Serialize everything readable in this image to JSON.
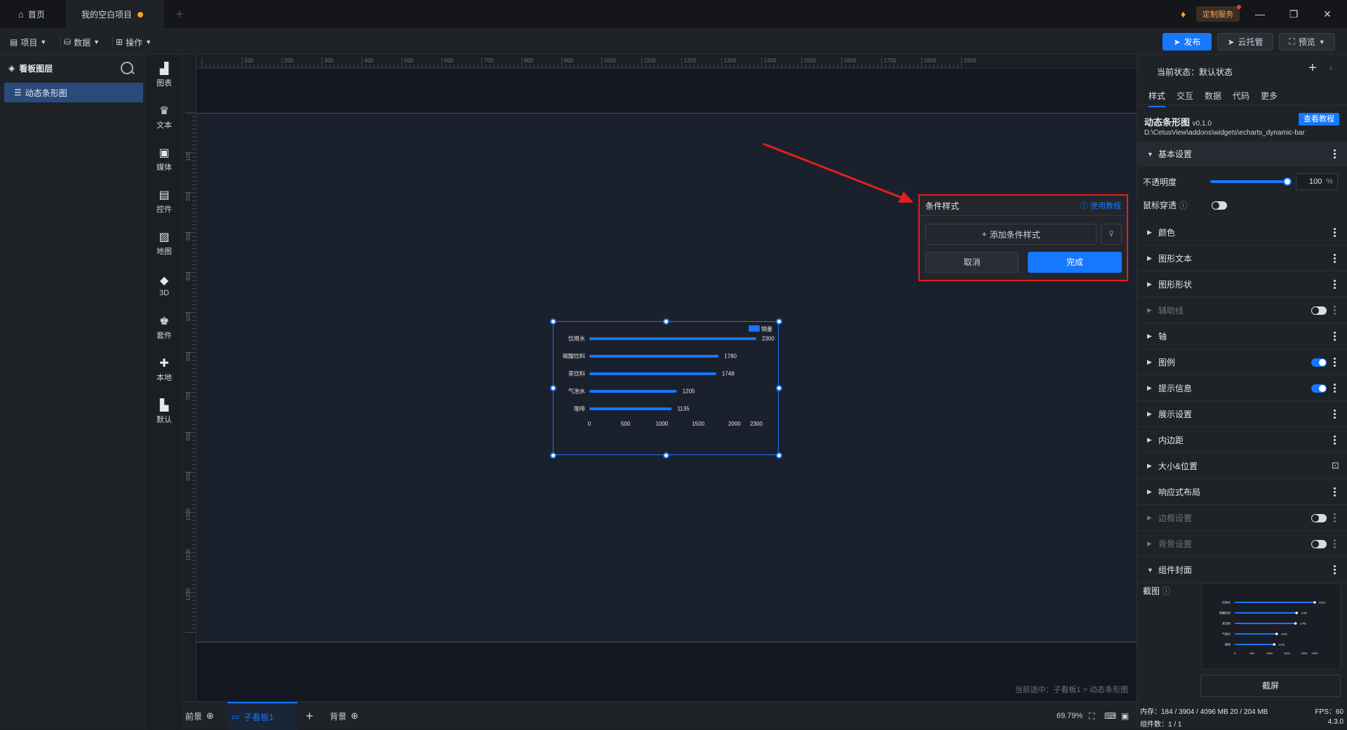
{
  "titlebar": {
    "home_label": "首页",
    "project_tab": "我的空白项目",
    "custom_service": "定制服务",
    "minimize": "—",
    "restore": "❐",
    "close": "✕"
  },
  "menubar": {
    "project": "项目",
    "data": "数据",
    "operate": "操作",
    "publish": "发布",
    "cloud": "云托管",
    "preview": "预览"
  },
  "layers": {
    "title": "看板图层",
    "items": [
      {
        "label": "动态条形图"
      }
    ]
  },
  "rail": [
    {
      "label": "图表",
      "icon": "bar-chart-icon"
    },
    {
      "label": "文本",
      "icon": "text-icon"
    },
    {
      "label": "媒体",
      "icon": "media-icon"
    },
    {
      "label": "控件",
      "icon": "widget-icon"
    },
    {
      "label": "地图",
      "icon": "map-icon"
    },
    {
      "label": "3D",
      "icon": "cube-icon"
    },
    {
      "label": "套件",
      "icon": "kit-icon"
    },
    {
      "label": "本地",
      "icon": "puzzle-icon"
    },
    {
      "label": "默认",
      "icon": "default-chart-icon"
    }
  ],
  "ruler": {
    "top": [
      "100",
      "200",
      "300",
      "400",
      "500",
      "600",
      "700",
      "800",
      "900",
      "1000",
      "1100",
      "1200",
      "1300",
      "1400",
      "1500",
      "1600",
      "1700",
      "1800",
      "1900"
    ],
    "left": [
      "100",
      "200",
      "300",
      "400",
      "500",
      "600",
      "700",
      "800",
      "900",
      "1000",
      "1100",
      "1200"
    ]
  },
  "chart_data": {
    "type": "bar",
    "orientation": "horizontal",
    "categories": [
      "饮用水",
      "碳酸饮料",
      "茶饮料",
      "气泡水",
      "咖啡"
    ],
    "series": [
      {
        "name": "销量",
        "values": [
          2300,
          1780,
          1748,
          1205,
          1135
        ]
      }
    ],
    "xticks": [
      "0",
      "500",
      "1000",
      "1500",
      "2000",
      "2300"
    ],
    "xlim": [
      0,
      2300
    ],
    "legend": "top-right",
    "color": "#1677ff"
  },
  "cond_panel": {
    "title": "条件样式",
    "help": "使用教程",
    "add": "添加条件样式",
    "cancel": "取消",
    "done": "完成"
  },
  "breadcrumb": "当前选中：子看板1 > 动态条形图",
  "bottom": {
    "foreground": "前景",
    "subboard": "子看板1",
    "background": "背景",
    "zoom": "69.79%"
  },
  "right": {
    "state": "当前状态：默认状态",
    "tabs": [
      "样式",
      "交互",
      "数据",
      "代码",
      "更多"
    ],
    "component_name": "动态条形图",
    "version": "v0.1.0",
    "tutorial": "查看教程",
    "path": "D:\\CetusView\\addons\\widgets\\echarts_dynamic-bar",
    "basic": "基本设置",
    "opacity_label": "不透明度",
    "opacity_value": "100",
    "percent": "%",
    "mouse_through": "鼠标穿透",
    "sections": [
      {
        "label": "颜色"
      },
      {
        "label": "图形文本"
      },
      {
        "label": "图形形状"
      },
      {
        "label": "辅助线"
      },
      {
        "label": "轴"
      },
      {
        "label": "图例"
      },
      {
        "label": "提示信息"
      },
      {
        "label": "展示设置"
      },
      {
        "label": "内边距"
      },
      {
        "label": "大小&位置"
      },
      {
        "label": "响应式布局"
      },
      {
        "label": "边框设置"
      },
      {
        "label": "背景设置"
      },
      {
        "label": "组件封面"
      }
    ],
    "screenshot_label": "截图",
    "capture": "截屏",
    "memory": "内存：184 / 3904 / 4096 MB  20 / 204 MB",
    "fps": "FPS：60",
    "component_count": "组件数：1 / 1",
    "app_version": "4.3.0"
  }
}
